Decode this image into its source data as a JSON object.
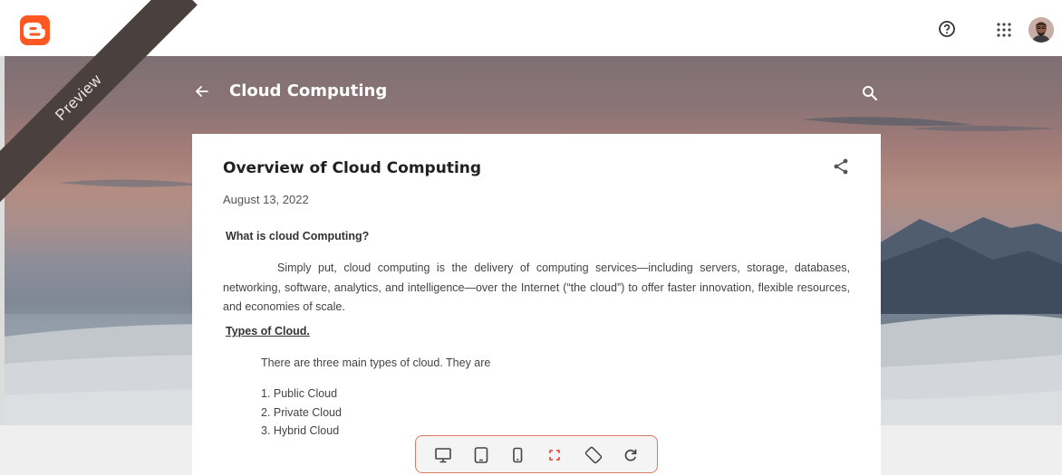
{
  "topbar": {
    "logo_icon": "blogger-logo-icon",
    "help_icon": "help-circle-icon",
    "apps_icon": "apps-grid-icon",
    "avatar_icon": "user-avatar"
  },
  "hero": {
    "ribbon_label": "Preview",
    "blog_title": "Cloud Computing",
    "back_icon": "arrow-left-icon",
    "search_icon": "search-icon"
  },
  "post": {
    "title": "Overview of Cloud Computing",
    "date": "August 13, 2022",
    "question_heading": "What is cloud Computing?",
    "paragraph": "Simply put, cloud computing is the delivery of computing services—including servers, storage, databases, networking, software, analytics, and intelligence—over the Internet (“the cloud”) to offer faster innovation, flexible resources, and economies of scale.",
    "types_heading": "Types of Cloud.",
    "types_intro": "There are three main types of cloud. They are",
    "types": [
      "1. Public Cloud",
      "2. Private Cloud",
      "3. Hybrid Cloud"
    ],
    "share_icon": "share-icon"
  },
  "device_toolbar": {
    "buttons": [
      "desktop-icon",
      "tablet-icon",
      "mobile-icon",
      "fullscreen-icon",
      "rotate-icon",
      "refresh-icon"
    ],
    "accent_color": "#e07a5f"
  }
}
